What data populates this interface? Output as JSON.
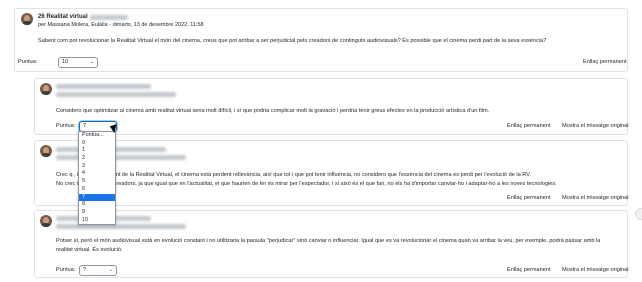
{
  "posts": [
    {
      "subject": "26 Realitat virtual",
      "byline": "per Massana Molera, Eulàlia - dimarts, 13 de desembre 2022, 11:58",
      "lines": [
        "Sabent com pot revolucionar la Realitat Virtual el món del cinema, creus que pot arribar a ser perjudicial pels creadors de continguts audiovisuals? És possible que el cinema perdi part de la seva essència?"
      ],
      "rating_label": "Puntua:",
      "rating_value": "10",
      "permalink": "Enllaç permanent"
    },
    {
      "lines": [
        "Considero que optimitzar al cinema amb realitat virtual seria molt difícil, i sí que podria complicar molt la gravació i perdria tenir greus efectes en la producció artística d'un film."
      ],
      "rating_label": "Puntua:",
      "rating_value": "7",
      "permalink": "Enllaç permanent",
      "show_parent": "Mostra el missatge original"
    },
    {
      "lines": [
        "Crec q                , independentment de la Realitat Virtual, el cinema està perdent rellevància, així que tot i que pot tenir influència, no considero que l'essència del cinema es perdi per l'evolució de la RV.",
        "No crec                 important pels creadors, ja que igual que en l'actualitat, el que haurien de fer és mirar per l'espectador, i si això és el que fan, no els ha d'importar canviar-ho i adaptar-ho a les noves tecnologies."
      ],
      "permalink": "Enllaç permanent",
      "show_parent": "Mostra el missatge original"
    },
    {
      "lines": [
        "Potser sí, però el món audiovisual està en evolució constant i no utilitzaria la paraula \"perjudicar\" sinó canviar o influenciar. Igual que es va revolucionar el cinema quan va arribar la veu, per exemple, podrà passar amb la",
        "realitat virtual. És evolució."
      ],
      "rating_label": "Puntua:",
      "rating_value": "?",
      "permalink": "Enllaç permanent",
      "show_parent": "Mostra el missatge original"
    }
  ],
  "dropdown_options": [
    "Puntua...",
    "0",
    "1",
    "2",
    "3",
    "4",
    "5",
    "6",
    "7",
    "8",
    "9",
    "10"
  ],
  "dropdown_selected": "7",
  "colors": {
    "selected": "#1a73e8",
    "focus": "#0f6cbf"
  }
}
